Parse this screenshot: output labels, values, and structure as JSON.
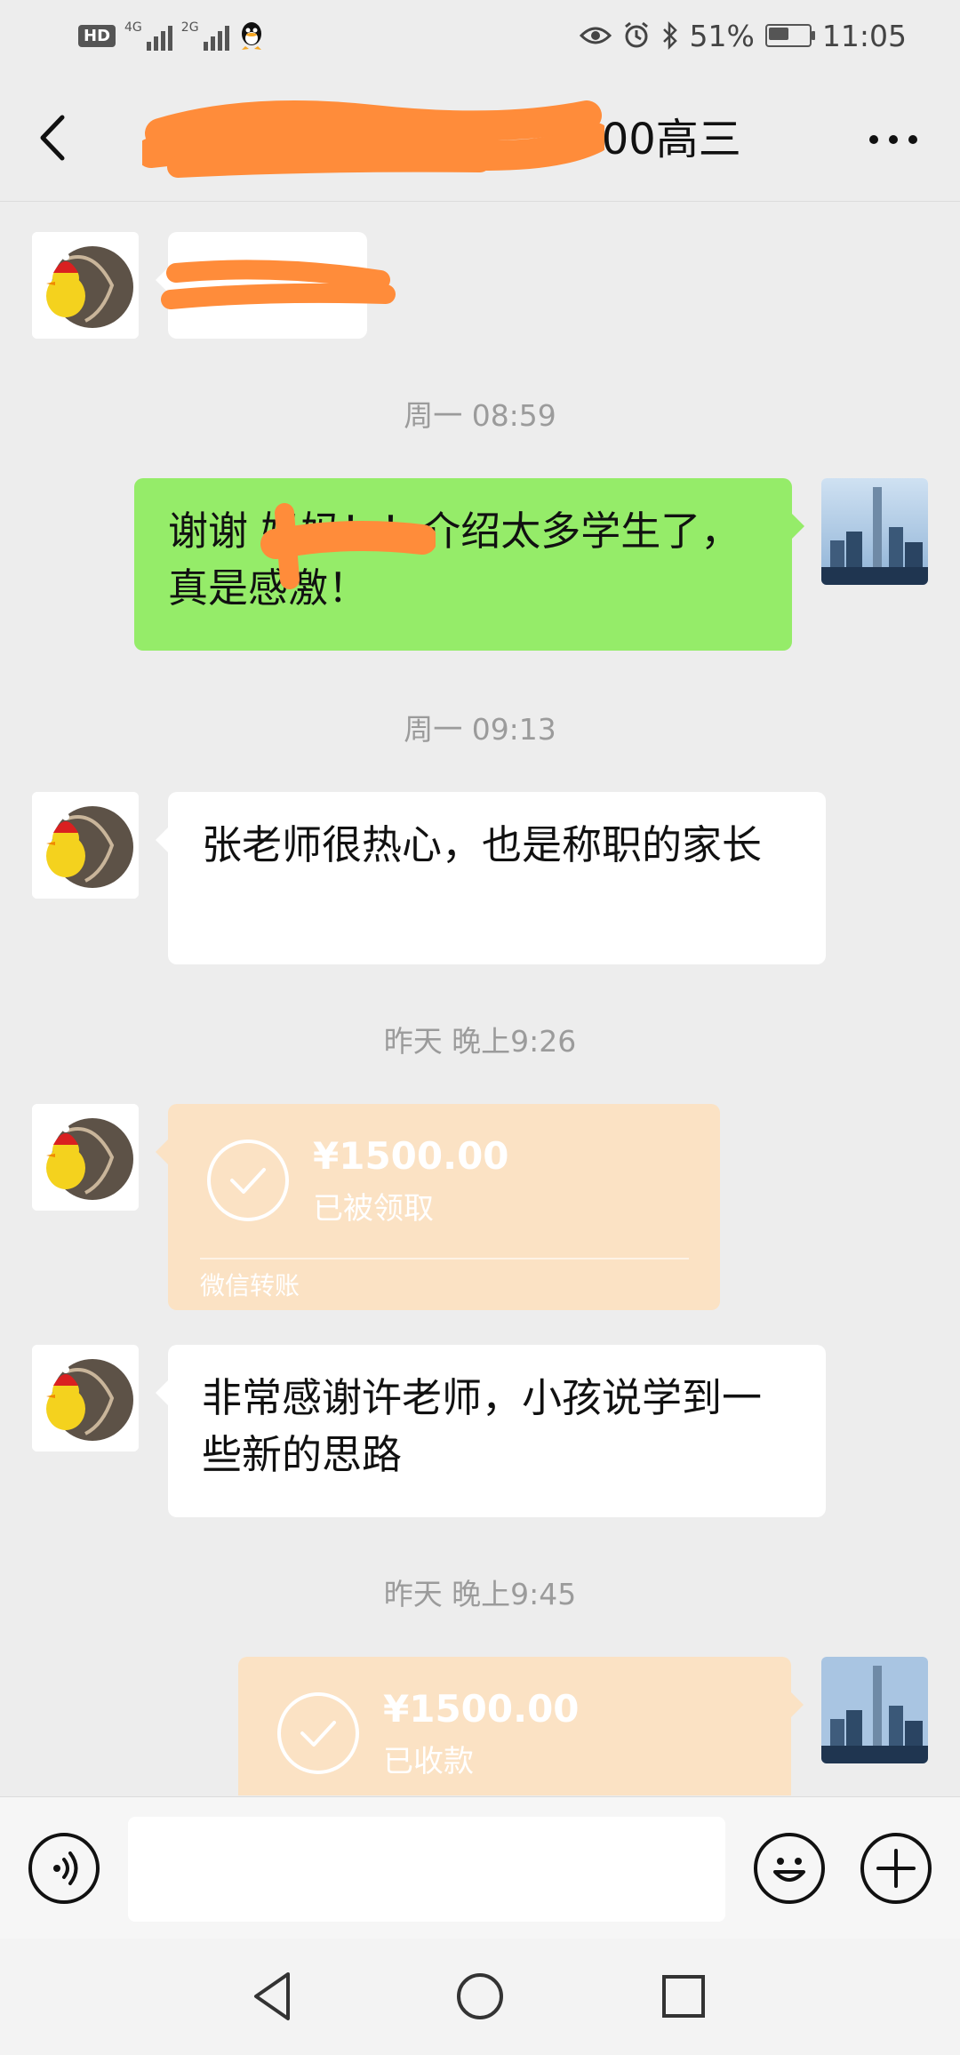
{
  "status_bar": {
    "hd": "HD",
    "net1": "4G",
    "net2": "2G",
    "battery": "51%",
    "time": "11:05"
  },
  "header": {
    "title_visible": "000高三"
  },
  "messages": {
    "time1": "周一 08:59",
    "msg_sent_1": "谢谢 妈妈！！介绍太多学生了，真是感激！",
    "time2": "周一 09:13",
    "msg_recv_1": "张老师很热心，也是称职的家长",
    "time3": "昨天 晚上9:26",
    "transfer1": {
      "amount": "¥1500.00",
      "status": "已被领取",
      "footer": "微信转账"
    },
    "msg_recv_2": "非常感谢许老师，小孩说学到一些新的思路",
    "time4": "昨天 晚上9:45",
    "transfer2": {
      "amount": "¥1500.00",
      "status": "已收款"
    }
  },
  "colors": {
    "green_bubble": "#95ec69",
    "transfer_bg": "#fbe2c4",
    "redact": "#ff8c3a"
  }
}
